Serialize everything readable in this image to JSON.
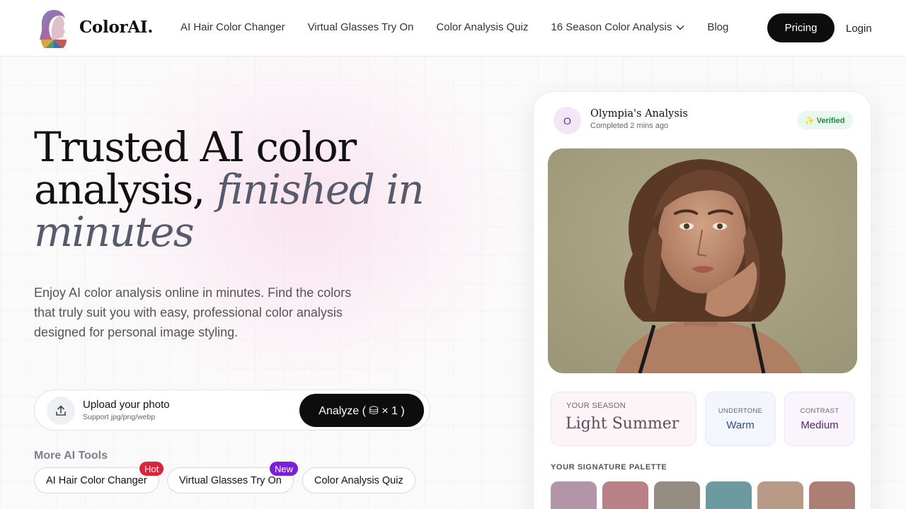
{
  "header": {
    "brand": "ColorAI.",
    "nav": [
      {
        "label": "AI Hair Color Changer"
      },
      {
        "label": "Virtual Glasses Try On"
      },
      {
        "label": "Color Analysis Quiz"
      },
      {
        "label": "16 Season Color Analysis",
        "has_dropdown": true
      },
      {
        "label": "Blog"
      }
    ],
    "pricing_label": "Pricing",
    "login_label": "Login"
  },
  "hero": {
    "title_line1": "Trusted AI color",
    "title_line2_plain": "analysis, ",
    "title_line2_italic": "finished in",
    "title_line3_italic": "minutes",
    "subtitle": "Enjoy AI color analysis online in minutes. Find the colors that truly suit you with easy, professional color analysis designed for personal image styling."
  },
  "upload": {
    "title": "Upload your photo",
    "hint": "Support jpg/png/webp",
    "analyze_label": "Analyze ( ⛁ × 1 )",
    "icon": "upload-icon"
  },
  "more_tools": {
    "heading": "More AI Tools",
    "tools": [
      {
        "label": "AI Hair Color Changer",
        "tag": "Hot",
        "tag_color": "#d8263c"
      },
      {
        "label": "Virtual Glasses Try On",
        "tag": "New",
        "tag_color": "#7a1fd6"
      },
      {
        "label": "Color Analysis Quiz"
      }
    ]
  },
  "card": {
    "avatar_initial": "O",
    "title": "Olympia's Analysis",
    "subtitle": "Completed 2 mins ago",
    "verified": "✨ Verified",
    "season_label": "YOUR SEASON",
    "season_value": "Light Summer",
    "undertone_label": "UNDERTONE",
    "undertone_value": "Warm",
    "contrast_label": "CONTRAST",
    "contrast_value": "Medium",
    "palette_label": "YOUR SIGNATURE PALETTE",
    "palette": [
      "#b395aa",
      "#b98088",
      "#958d81",
      "#6b9aa0",
      "#b99a86",
      "#ad7f74"
    ]
  },
  "colors": {
    "accent_dark": "#0d0d0d",
    "undertone_text": "#2d4e7e",
    "contrast_text": "#5a2272"
  }
}
